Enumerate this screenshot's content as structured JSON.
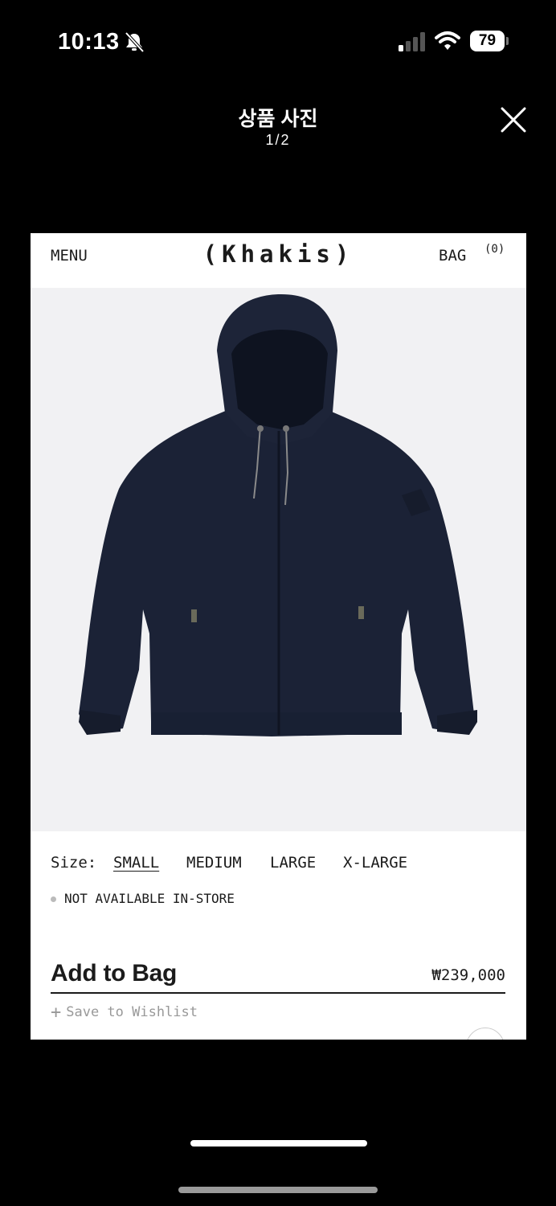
{
  "status_bar": {
    "time": "10:13",
    "battery": "79",
    "icons": [
      "bell-off-icon",
      "signal-icon",
      "wifi-icon",
      "battery-icon"
    ]
  },
  "viewer": {
    "title": "상품 사진",
    "counter": "1/2",
    "close_icon": "close-icon"
  },
  "site": {
    "menu": "MENU",
    "logo": "(Khakis)",
    "bag": "BAG",
    "bag_count": "(0)"
  },
  "product": {
    "image_desc": "navy-hooded-jacket",
    "colors": {
      "jacket": "#1b2236",
      "background": "#f1f1f3"
    },
    "size_label": "Size:",
    "sizes": [
      "SMALL",
      "MEDIUM",
      "LARGE",
      "X-LARGE"
    ],
    "selected_size": "SMALL",
    "availability": "NOT AVAILABLE IN-STORE",
    "add_to_bag": "Add to Bag",
    "price": "₩239,000",
    "wishlist": "Save to Wishlist",
    "wishlist_icon": "plus-icon"
  }
}
